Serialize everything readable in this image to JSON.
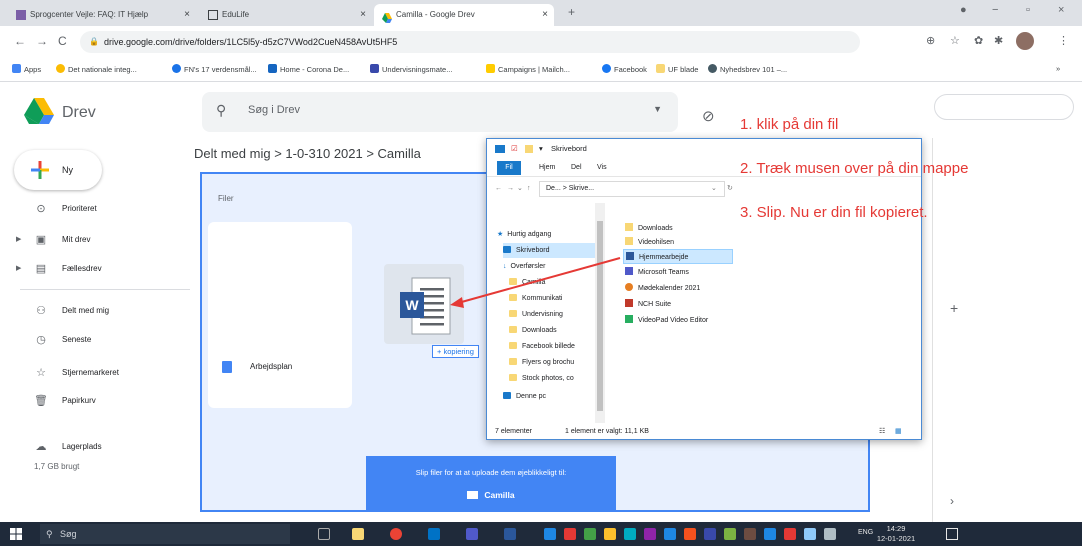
{
  "browser": {
    "tabs": [
      {
        "label": "Sprogcenter Vejle: FAQ: IT Hjælp"
      },
      {
        "label": "EduLife"
      },
      {
        "label": "Camilla - Google Drev"
      }
    ],
    "url": "drive.google.com/drive/folders/1LC5l5y-d5zC7VWod2CueN458AvUt5HF5",
    "bookmarks": [
      "Apps",
      "Det nationale integ...",
      "FN's 17 verdensmål...",
      "Home - Corona De...",
      "Undervisningsmate...",
      "Campaigns | Mailch...",
      "Facebook",
      "UF blade",
      "Nyhedsbrev 101 –..."
    ]
  },
  "drive": {
    "title": "Drev",
    "search_placeholder": "Søg i Drev",
    "new_label": "Ny",
    "nav": [
      {
        "label": "Prioriteret",
        "icon": "check-circle-icon"
      },
      {
        "label": "Mit drev",
        "icon": "my-drive-icon"
      },
      {
        "label": "Fællesdrev",
        "icon": "shared-drives-icon"
      },
      {
        "label": "Delt med mig",
        "icon": "shared-with-me-icon"
      },
      {
        "label": "Seneste",
        "icon": "clock-icon"
      },
      {
        "label": "Stjernemarkeret",
        "icon": "star-icon"
      },
      {
        "label": "Papirkurv",
        "icon": "trash-icon"
      },
      {
        "label": "Lagerplads",
        "icon": "cloud-icon"
      }
    ],
    "storage_used": "1,7 GB brugt",
    "breadcrumb": "Delt med mig  >  1-0-310 2021  >  Camilla",
    "files_header": "Filer",
    "file_name": "Arbejdsplan",
    "copy_badge": "+ kopiering",
    "upload_text": "Slip filer for at at uploade dem øjeblikkeligt til:",
    "upload_folder": "Camilla"
  },
  "explorer": {
    "title": "Skrivebord",
    "ribbon": [
      "Fil",
      "Hjem",
      "Del",
      "Vis"
    ],
    "address": "De... > Skrive...",
    "nav_items": [
      "Hurtig adgang",
      "Skrivebord",
      "Overførsler",
      "Camilla",
      "Kommunikati",
      "Undervisning",
      "Downloads",
      "Facebook billede",
      "Flyers og brochu",
      "Stock photos, co",
      "Denne pc"
    ],
    "files": [
      "Downloads",
      "Videohilsen",
      "Hjemmearbejde",
      "Microsoft Teams",
      "Mødekalender 2021",
      "NCH Suite",
      "VideoPad Video Editor"
    ],
    "status_count": "7 elementer",
    "status_selected": "1 element er valgt: 11,1 KB"
  },
  "instructions": [
    "1. klik på din fil",
    "2. Træk musen over på din mappe",
    "3. Slip. Nu er din fil kopieret."
  ],
  "taskbar": {
    "search": "Søg",
    "lang": "ENG",
    "time": "14:29",
    "date": "12-01-2021"
  },
  "colors": {
    "accent": "#4285f4",
    "instruction_red": "#e53935",
    "drop_zone_bg": "#e8f0fe"
  }
}
